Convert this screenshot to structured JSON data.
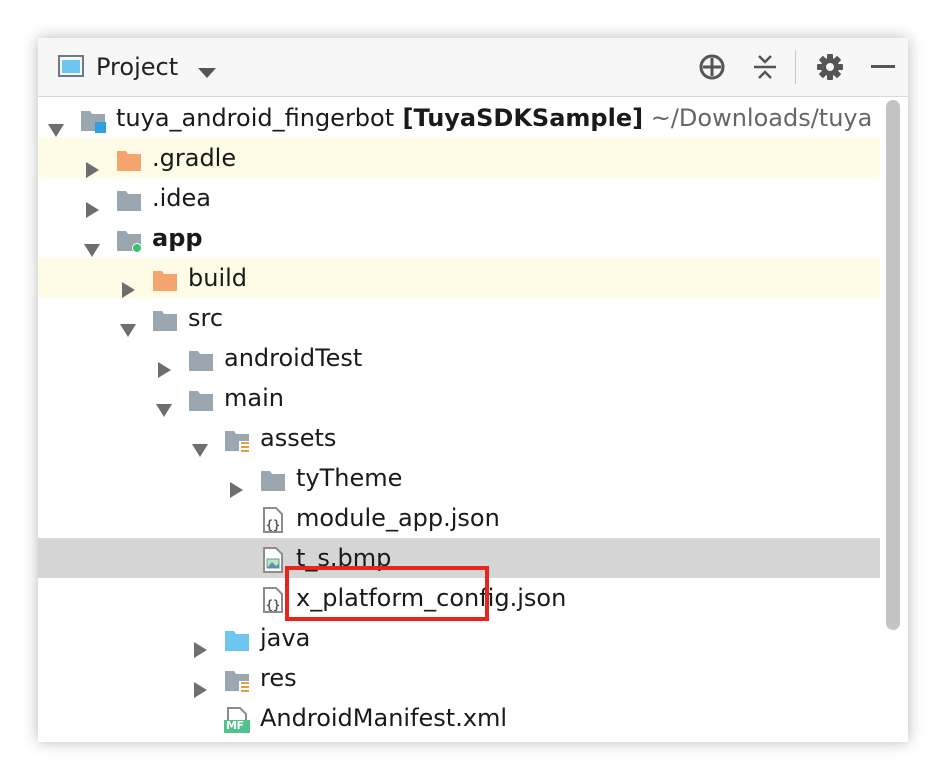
{
  "header": {
    "title": "Project",
    "icons": [
      "project-view-icon",
      "dropdown-icon",
      "locate-icon",
      "collapse-all-icon",
      "gear-icon",
      "minimize-icon"
    ]
  },
  "tree": [
    {
      "label": "tuya_android_fingerbot",
      "bold_suffix": "[TuyaSDKSample]",
      "path_suffix": "~/Downloads/tuya",
      "icon": "module-folder-icon",
      "level": 0,
      "arrow": "expanded"
    },
    {
      "label": ".gradle",
      "icon": "excluded-folder-icon",
      "level": 1,
      "arrow": "collapsed"
    },
    {
      "label": ".idea",
      "icon": "folder-icon",
      "level": 1,
      "arrow": "collapsed"
    },
    {
      "label": "app",
      "icon": "android-module-icon",
      "level": 1,
      "arrow": "expanded"
    },
    {
      "label": "build",
      "icon": "excluded-folder-icon",
      "level": 2,
      "arrow": "collapsed"
    },
    {
      "label": "src",
      "icon": "folder-icon",
      "level": 2,
      "arrow": "expanded"
    },
    {
      "label": "androidTest",
      "icon": "folder-icon",
      "level": 3,
      "arrow": "collapsed"
    },
    {
      "label": "main",
      "icon": "folder-icon",
      "level": 3,
      "arrow": "expanded"
    },
    {
      "label": "assets",
      "icon": "resource-folder-icon",
      "level": 4,
      "arrow": "expanded"
    },
    {
      "label": "tyTheme",
      "icon": "folder-icon",
      "level": 5,
      "arrow": "collapsed"
    },
    {
      "label": "module_app.json",
      "icon": "json-file-icon",
      "level": 5,
      "arrow": "none"
    },
    {
      "label": "t_s.bmp",
      "icon": "image-file-icon",
      "level": 5,
      "arrow": "none"
    },
    {
      "label": "x_platform_config.json",
      "icon": "json-file-icon",
      "level": 5,
      "arrow": "none"
    },
    {
      "label": "java",
      "icon": "source-folder-icon",
      "level": 4,
      "arrow": "collapsed"
    },
    {
      "label": "res",
      "icon": "resource-folder-icon",
      "level": 4,
      "arrow": "collapsed"
    },
    {
      "label": "AndroidManifest.xml",
      "icon": "manifest-file-icon",
      "badge": "MF",
      "level": 4,
      "arrow": "none"
    }
  ],
  "colors": {
    "folder": "#9aa7b0",
    "excluded_folder": "#f4a46c",
    "source_folder": "#6ec6f0",
    "highlight_row": "#fefbe6",
    "selected_row": "#d5d5d5",
    "callout_border": "#e8251c",
    "module_badge": "#2f9fe0",
    "android_dot": "#38c172",
    "resource_lines": "#e0a040",
    "manifest_badge": "#4fc38b"
  }
}
